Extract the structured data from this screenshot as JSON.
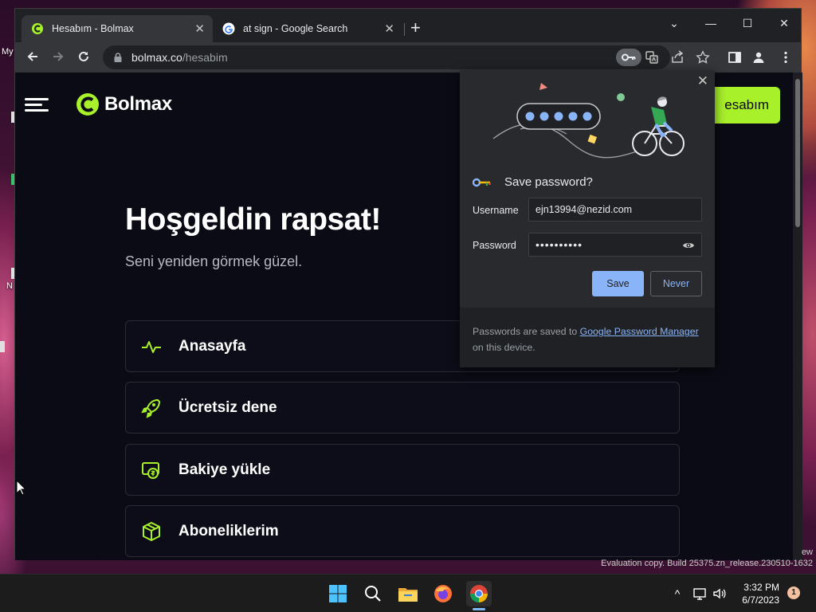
{
  "desktop": {
    "label_top": "My",
    "label_mid": "N",
    "watermark_line1": "ew",
    "watermark_line2": "Evaluation copy. Build 25375.zn_release.230510-1632"
  },
  "browser": {
    "tabs": [
      {
        "title": "Hesabım - Bolmax",
        "active": true
      },
      {
        "title": "at sign - Google Search",
        "active": false
      }
    ],
    "new_tab": "+",
    "window_controls": {
      "chevron": "⌄",
      "minimize": "—",
      "maximize": "☐",
      "close": "✕"
    },
    "address": {
      "host": "bolmax.co",
      "path": "/hesabim"
    }
  },
  "page": {
    "logo_text": "Bolmax",
    "account_button": "esabım",
    "heading": "Hoşgeldin rapsat!",
    "subheading": "Seni yeniden görmek güzel.",
    "menu": [
      {
        "label": "Anasayfa",
        "icon": "activity-icon"
      },
      {
        "label": "Ücretsiz dene",
        "icon": "rocket-icon"
      },
      {
        "label": "Bakiye yükle",
        "icon": "money-icon"
      },
      {
        "label": "Aboneliklerim",
        "icon": "box-icon"
      }
    ],
    "accent_color": "#a8f12a"
  },
  "save_password": {
    "title": "Save password?",
    "username_label": "Username",
    "username_value": "ejn13994@nezid.com",
    "password_label": "Password",
    "password_value": "••••••••••",
    "save_label": "Save",
    "never_label": "Never",
    "footer_prefix": "Passwords are saved to ",
    "footer_link": "Google Password Manager",
    "footer_suffix": " on this device."
  },
  "taskbar": {
    "time": "3:32 PM",
    "date": "6/7/2023",
    "notification_count": "1",
    "tray_chevron": "^"
  }
}
